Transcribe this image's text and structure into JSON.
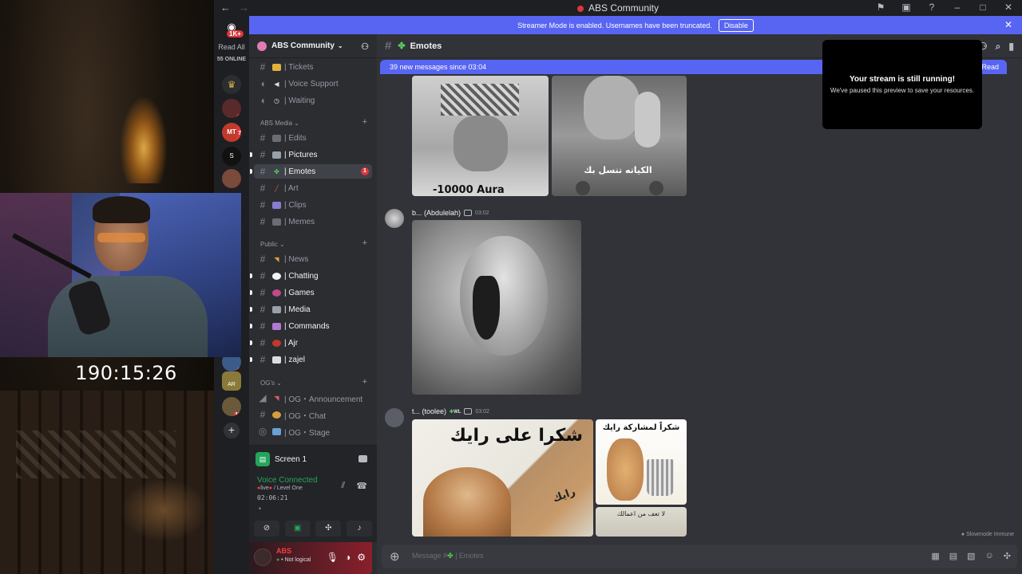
{
  "titlebar": {
    "title": "ABS Community",
    "back": "←",
    "forward": "→",
    "icons": [
      "flag",
      "screen",
      "help",
      "minimize",
      "maximize",
      "close"
    ]
  },
  "overlay": {
    "timer": "190:15:26"
  },
  "rail": {
    "logo_badge": "1K+",
    "read_all": "Read All",
    "online": "55 ONLINE",
    "servers": [
      {
        "badge": ""
      },
      {
        "badge": "1"
      },
      {
        "badge": "7",
        "label": "MT"
      },
      {
        "badge": "",
        "label": "S"
      },
      {
        "badge": ""
      },
      {
        "badge": "2"
      },
      {
        "badge": "",
        "label": "AR"
      },
      {
        "badge": "18"
      }
    ]
  },
  "banner": {
    "text": "Streamer Mode is enabled. Usernames have been truncated.",
    "button": "Disable"
  },
  "sidebar": {
    "guild_name": "ABS Community",
    "channels_top": [
      {
        "name": "| Tickets",
        "type": "text"
      },
      {
        "name": "| Voice Support",
        "type": "voice"
      },
      {
        "name": "| Waiting",
        "type": "voice"
      }
    ],
    "category_media": "ABS Media",
    "channels_media": [
      {
        "name": "| Edits"
      },
      {
        "name": "| Pictures",
        "unread": true
      },
      {
        "name": "| Emotes",
        "active": true,
        "mention": "1"
      },
      {
        "name": "| Art"
      },
      {
        "name": "| Clips"
      },
      {
        "name": "| Memes"
      }
    ],
    "category_public": "Public",
    "channels_public": [
      {
        "name": "| News"
      },
      {
        "name": "| Chatting",
        "unread": true
      },
      {
        "name": "| Games",
        "unread": true
      },
      {
        "name": "| Media",
        "unread": true
      },
      {
        "name": "| Commands",
        "unread": true
      },
      {
        "name": "| Ajr",
        "unread": true
      },
      {
        "name": "| zajel",
        "unread": true
      }
    ],
    "category_og": "OG's",
    "channels_og": [
      {
        "name": "| OG・Announcement"
      },
      {
        "name": "| OG・Chat"
      },
      {
        "name": "| OG・Stage"
      }
    ]
  },
  "voice": {
    "screen": "Screen 1",
    "connected": "Voice Connected",
    "live": "live",
    "level": "/ Level One",
    "elapsed": "02:06:21"
  },
  "user": {
    "name": "ABS",
    "status": "Not logical"
  },
  "channel": {
    "name": "Emotes"
  },
  "new_messages": {
    "text": "39 new messages since 03:04",
    "mark": "Mark As Read"
  },
  "messages": [
    {
      "captions": [
        "-10000 Aura",
        "الكياته تتسل بك"
      ]
    },
    {
      "author": "b... (Abdulelah)",
      "time": "03:02"
    },
    {
      "author": "t... (toolee)",
      "badge": "WL",
      "time": "03:02",
      "captions": [
        "شكرا على رايك",
        "رايك",
        "شكراً لمشاركة رايك",
        "لا تعف من اعمالك"
      ]
    }
  ],
  "slowmode": "Slowmode Immune",
  "composer": {
    "placeholder_prefix": "Message #",
    "placeholder_channel": "| Emotes"
  },
  "popup": {
    "title": "Your stream is still running!",
    "subtitle": "We've paused this preview to save your resources."
  }
}
